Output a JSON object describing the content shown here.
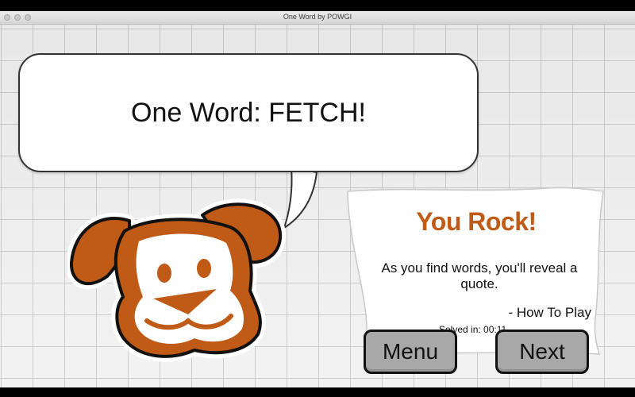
{
  "window": {
    "title": "One Word by POWGI"
  },
  "speech_bubble": {
    "text": "One Word: FETCH!"
  },
  "result_card": {
    "heading": "You Rock!",
    "quote": "As you find words, you'll reveal a quote.",
    "author": "- How To Play",
    "solved": "Solved in: 00:11"
  },
  "buttons": {
    "menu": "Menu",
    "next": "Next"
  },
  "colors": {
    "accent": "#c05a17",
    "button": "#a8a8a8",
    "grid": "#cdcdcd"
  },
  "icons": {
    "mascot": "dog-face-icon"
  }
}
